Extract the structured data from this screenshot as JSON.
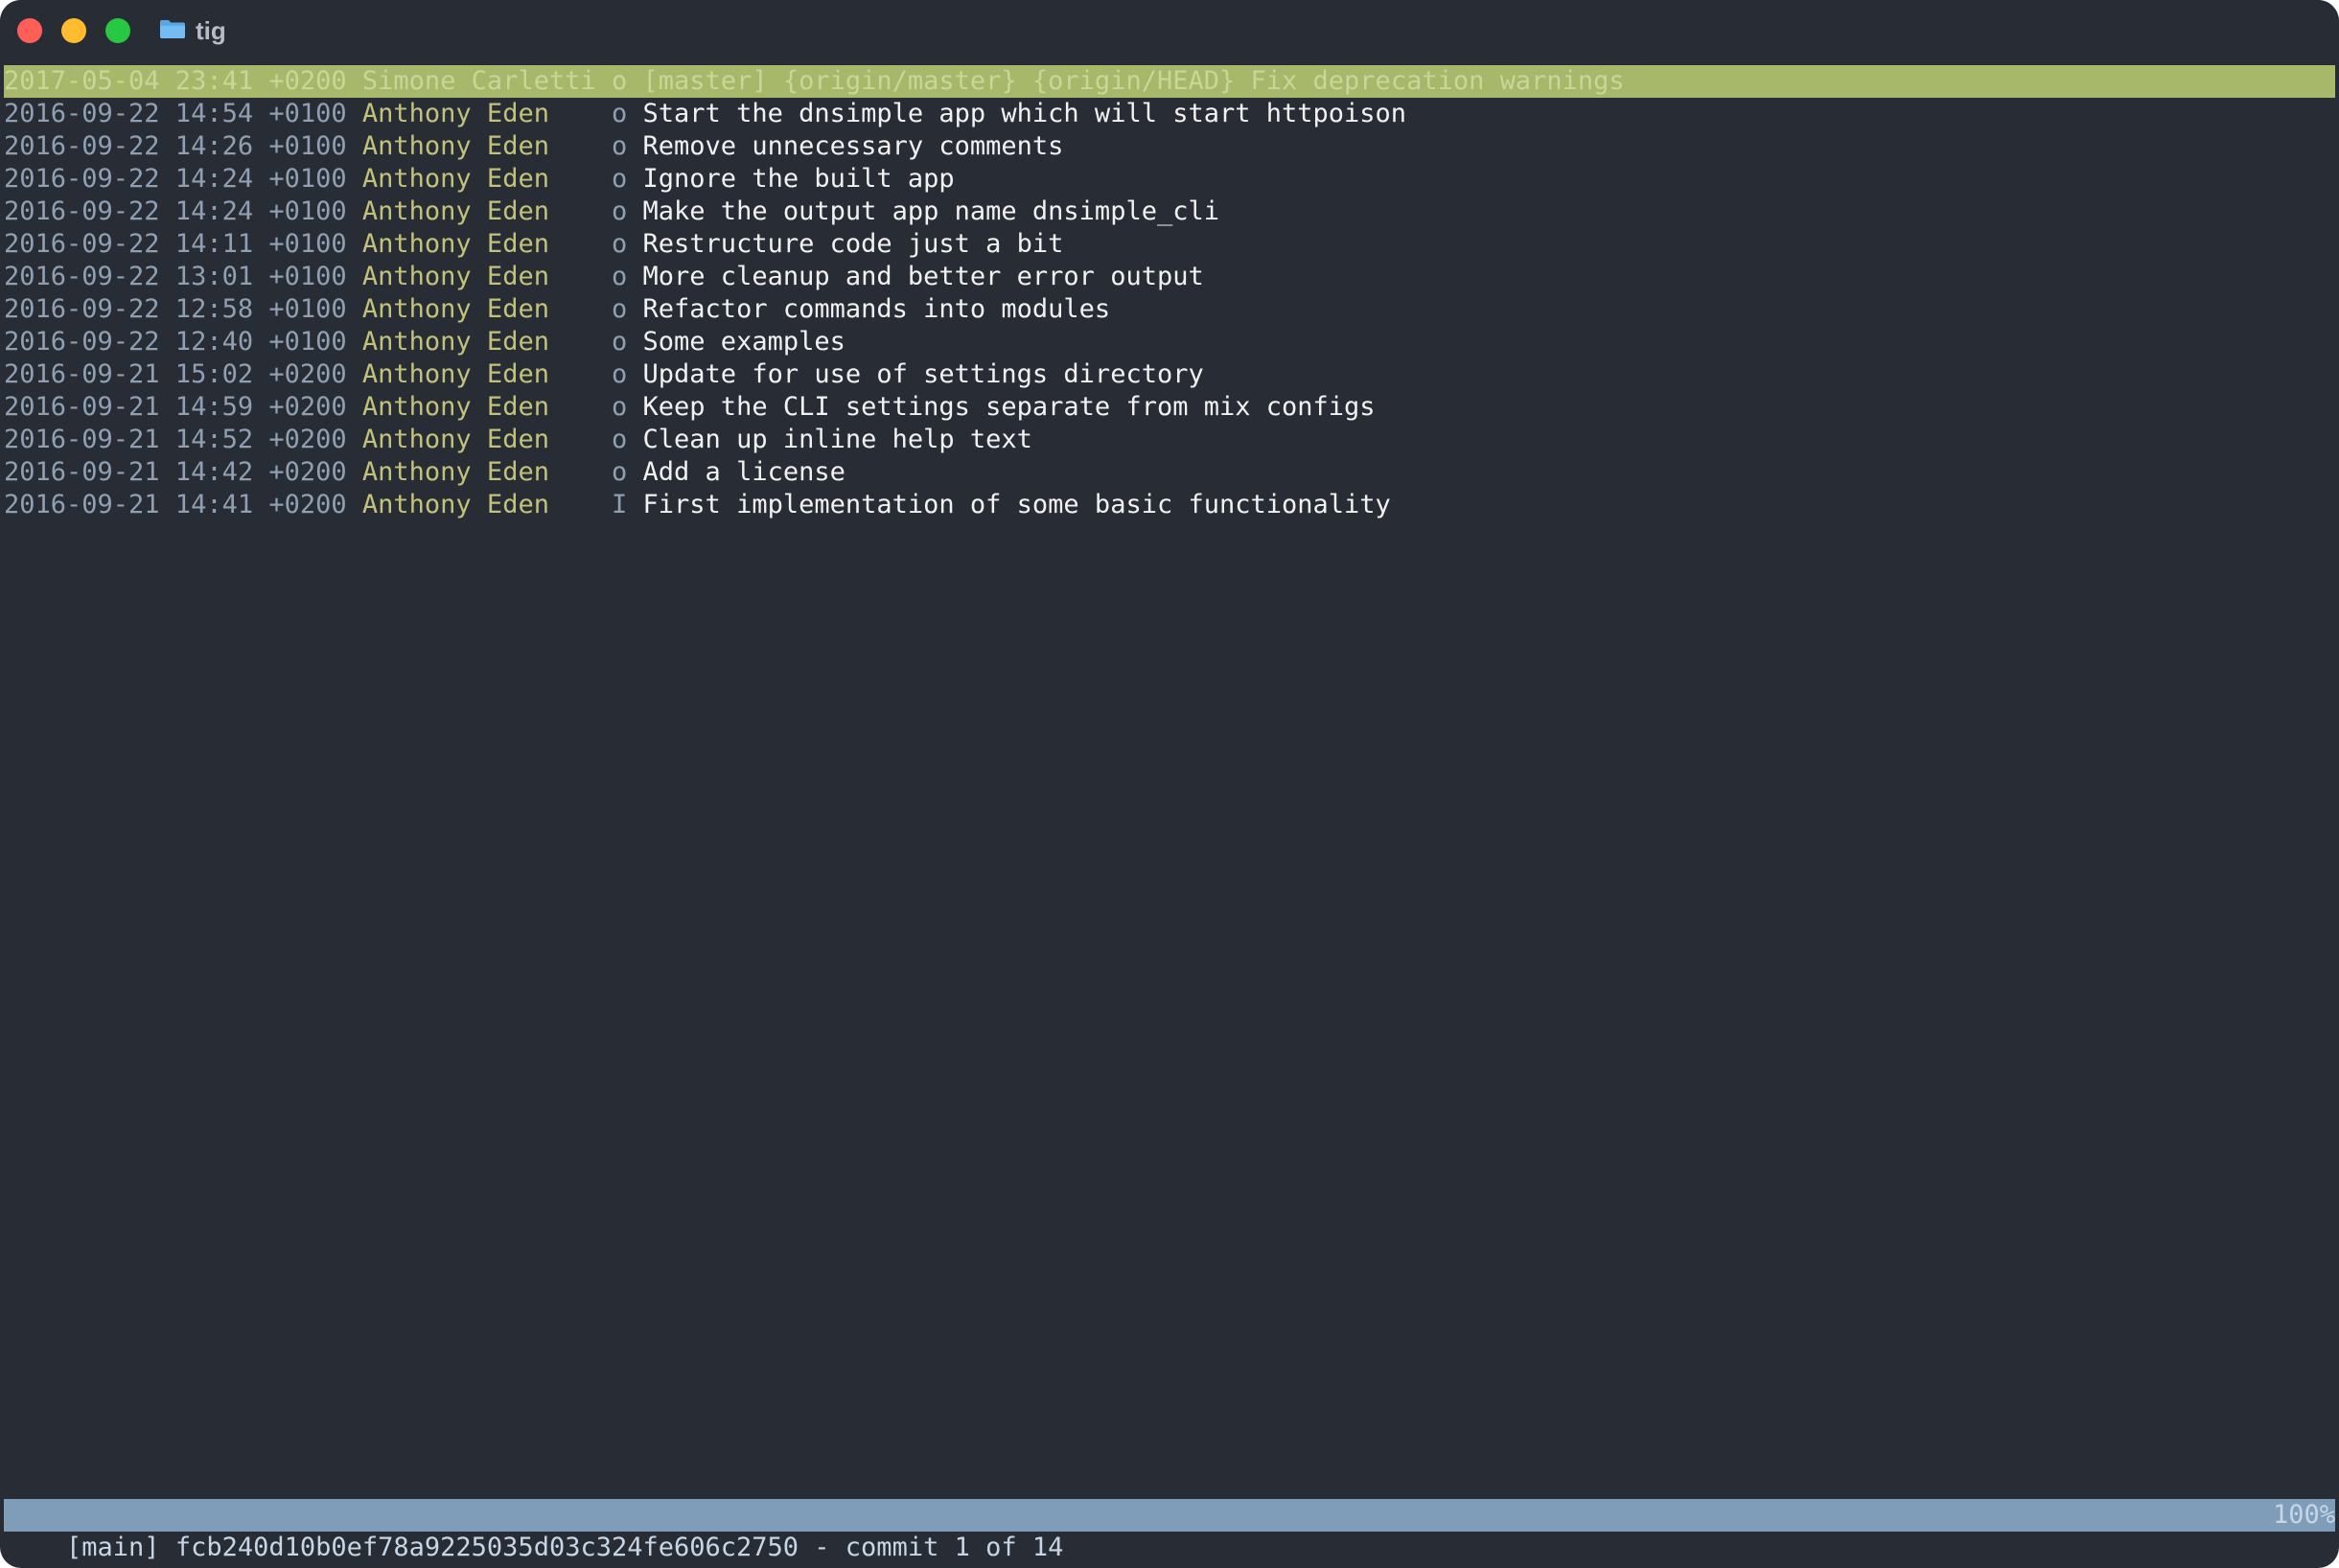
{
  "window": {
    "title": "tig"
  },
  "commits": [
    {
      "date": "2017-05-04 23:41 +0200",
      "author": "Simone Carletti",
      "graph": "o",
      "refs": "[master] {origin/master} {origin/HEAD}",
      "message": "Fix deprecation warnings",
      "selected": true
    },
    {
      "date": "2016-09-22 14:54 +0100",
      "author": "Anthony Eden",
      "graph": "o",
      "refs": "",
      "message": "Start the dnsimple app which will start httpoison"
    },
    {
      "date": "2016-09-22 14:26 +0100",
      "author": "Anthony Eden",
      "graph": "o",
      "refs": "",
      "message": "Remove unnecessary comments"
    },
    {
      "date": "2016-09-22 14:24 +0100",
      "author": "Anthony Eden",
      "graph": "o",
      "refs": "",
      "message": "Ignore the built app"
    },
    {
      "date": "2016-09-22 14:24 +0100",
      "author": "Anthony Eden",
      "graph": "o",
      "refs": "",
      "message": "Make the output app name dnsimple_cli"
    },
    {
      "date": "2016-09-22 14:11 +0100",
      "author": "Anthony Eden",
      "graph": "o",
      "refs": "",
      "message": "Restructure code just a bit"
    },
    {
      "date": "2016-09-22 13:01 +0100",
      "author": "Anthony Eden",
      "graph": "o",
      "refs": "",
      "message": "More cleanup and better error output"
    },
    {
      "date": "2016-09-22 12:58 +0100",
      "author": "Anthony Eden",
      "graph": "o",
      "refs": "",
      "message": "Refactor commands into modules"
    },
    {
      "date": "2016-09-22 12:40 +0100",
      "author": "Anthony Eden",
      "graph": "o",
      "refs": "",
      "message": "Some examples"
    },
    {
      "date": "2016-09-21 15:02 +0200",
      "author": "Anthony Eden",
      "graph": "o",
      "refs": "",
      "message": "Update for use of settings directory"
    },
    {
      "date": "2016-09-21 14:59 +0200",
      "author": "Anthony Eden",
      "graph": "o",
      "refs": "",
      "message": "Keep the CLI settings separate from mix configs"
    },
    {
      "date": "2016-09-21 14:52 +0200",
      "author": "Anthony Eden",
      "graph": "o",
      "refs": "",
      "message": "Clean up inline help text"
    },
    {
      "date": "2016-09-21 14:42 +0200",
      "author": "Anthony Eden",
      "graph": "o",
      "refs": "",
      "message": "Add a license"
    },
    {
      "date": "2016-09-21 14:41 +0200",
      "author": "Anthony Eden",
      "graph": "I",
      "refs": "",
      "message": "First implementation of some basic functionality"
    }
  ],
  "status": {
    "left": "[main] fcb240d10b0ef78a9225035d03c324fe606c2750 - commit 1 of 14",
    "right": "100%"
  },
  "colors": {
    "background": "#282c35",
    "selected_row": "#a7b86a",
    "status_bar": "#7f9db8",
    "date": "#8fa0b3",
    "author": "#c2c27a",
    "message": "#f2f2f2",
    "close": "#ff5f57",
    "minimize": "#febc2e",
    "zoom": "#28c840"
  },
  "icons": {
    "title": "folder-icon"
  }
}
